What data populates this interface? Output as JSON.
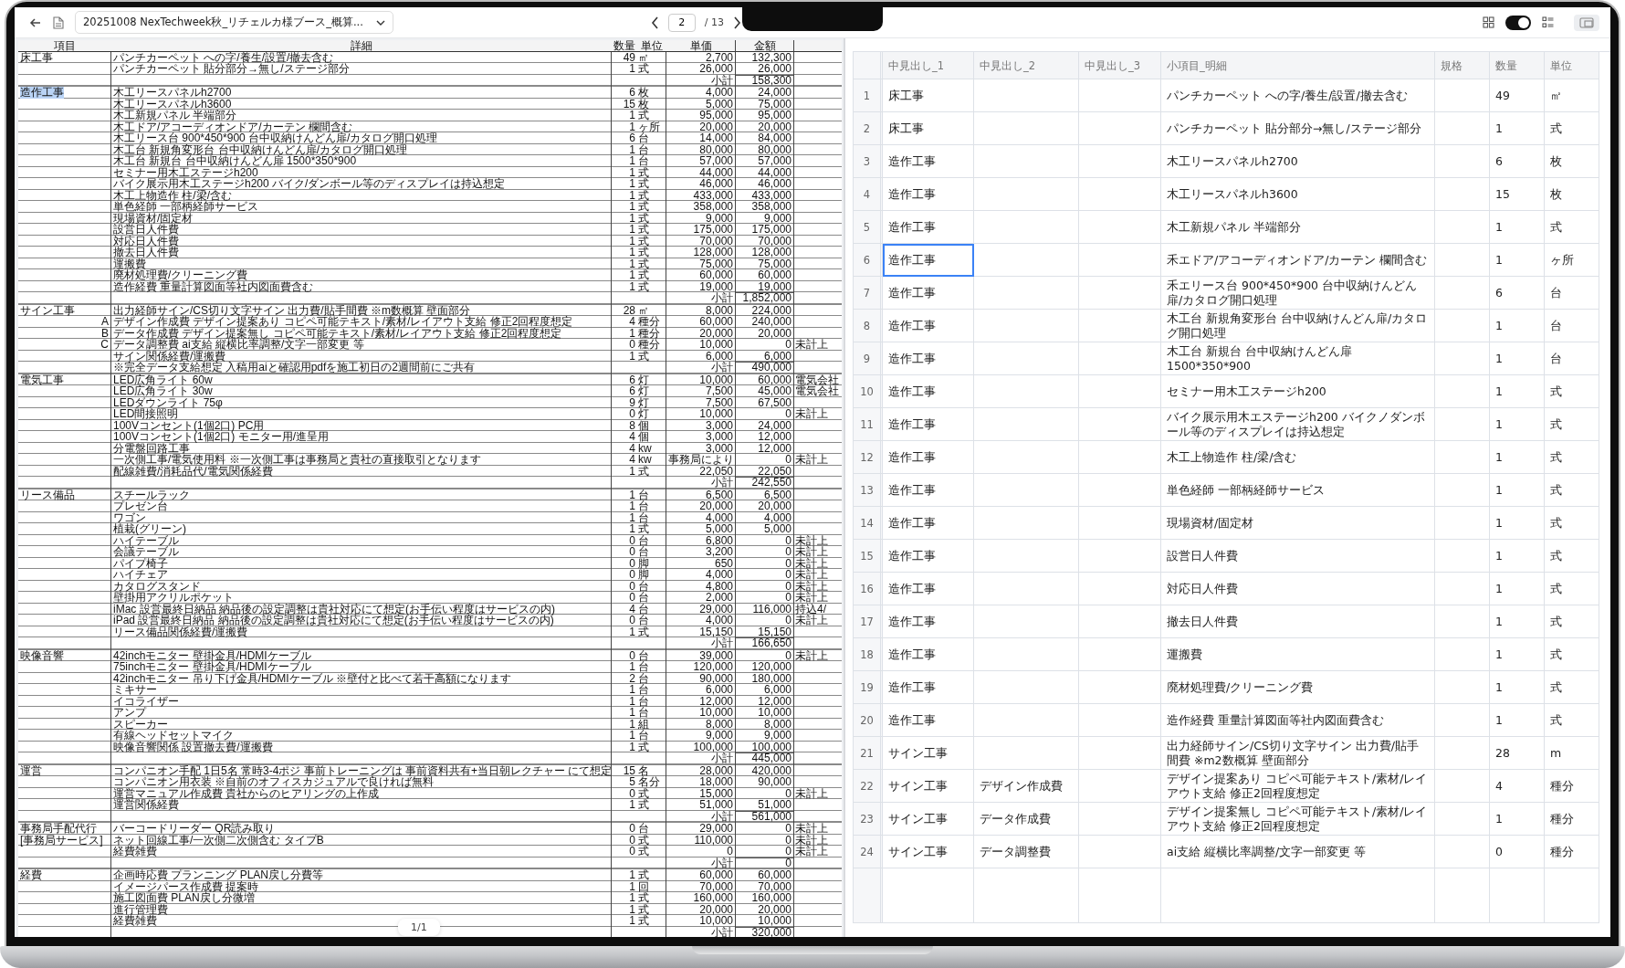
{
  "toolbar": {
    "file_title": "20251008 NexTechweek秋_リチェルカ様ブース_概算...",
    "page": "2",
    "page_total": "/ 13",
    "view_toggle": {
      "on": true
    }
  },
  "pdf": {
    "columns": [
      "項目",
      "詳細",
      "数量",
      "単位",
      "単価",
      "金額"
    ],
    "page_indicator": "1/1",
    "sections": [
      {
        "label": "床工事",
        "highlighted": false,
        "subtotal_label": "小計",
        "subtotal": "158,300",
        "rows": [
          {
            "detail": "パンチカーペット への字/養生/設置/撤去含む",
            "qty": "49",
            "unit": "㎡",
            "price": "2,700",
            "amount": "132,300"
          },
          {
            "detail": "パンチカーペット 貼分部分→無し/ステージ部分",
            "qty": "1",
            "unit": "式",
            "price": "26,000",
            "amount": "26,000"
          }
        ]
      },
      {
        "label": "造作工事",
        "highlighted": true,
        "subtotal_label": "小計",
        "subtotal": "1,852,000",
        "rows": [
          {
            "detail": "木工リースパネルh2700",
            "qty": "6",
            "unit": "枚",
            "price": "4,000",
            "amount": "24,000"
          },
          {
            "detail": "木工リースパネルh3600",
            "qty": "15",
            "unit": "枚",
            "price": "5,000",
            "amount": "75,000"
          },
          {
            "detail": "木工新規パネル 半端部分",
            "qty": "1",
            "unit": "式",
            "price": "95,000",
            "amount": "95,000"
          },
          {
            "detail": "木工ドア/アコーディオンドア/カーテン 欄間含む",
            "qty": "1",
            "unit": "ヶ所",
            "price": "20,000",
            "amount": "20,000"
          },
          {
            "detail": "木工リース台 900*450*900 台中収納けんどん扉/カタログ開口処理",
            "qty": "6",
            "unit": "台",
            "price": "14,000",
            "amount": "84,000"
          },
          {
            "detail": "木工台 新規角変形台 台中収納けんどん扉/カタログ開口処理",
            "qty": "1",
            "unit": "台",
            "price": "80,000",
            "amount": "80,000"
          },
          {
            "detail": "木工台 新規台 台中収納けんどん扉 1500*350*900",
            "qty": "1",
            "unit": "台",
            "price": "57,000",
            "amount": "57,000"
          },
          {
            "detail": "セミナー用木工ステージh200",
            "qty": "1",
            "unit": "式",
            "price": "44,000",
            "amount": "44,000"
          },
          {
            "detail": "バイク展示用木工ステージh200 バイク/ダンボール等のディスプレイは持込想定",
            "qty": "1",
            "unit": "式",
            "price": "46,000",
            "amount": "46,000"
          },
          {
            "detail": "木工上物造作 柱/梁/含む",
            "qty": "1",
            "unit": "式",
            "price": "433,000",
            "amount": "433,000"
          },
          {
            "detail": "単色経師 一部柄経師サービス",
            "qty": "1",
            "unit": "式",
            "price": "358,000",
            "amount": "358,000"
          },
          {
            "detail": "現場資材/固定材",
            "qty": "1",
            "unit": "式",
            "price": "9,000",
            "amount": "9,000"
          },
          {
            "detail": "設営日人件費",
            "qty": "1",
            "unit": "式",
            "price": "175,000",
            "amount": "175,000"
          },
          {
            "detail": "対応日人件費",
            "qty": "1",
            "unit": "式",
            "price": "70,000",
            "amount": "70,000"
          },
          {
            "detail": "撤去日人件費",
            "qty": "1",
            "unit": "式",
            "price": "128,000",
            "amount": "128,000"
          },
          {
            "detail": "運搬費",
            "qty": "1",
            "unit": "式",
            "price": "75,000",
            "amount": "75,000"
          },
          {
            "detail": "廃材処理費/クリーニング費",
            "qty": "1",
            "unit": "式",
            "price": "60,000",
            "amount": "60,000"
          },
          {
            "detail": "造作経費 重量計算図面等社内図面費含む",
            "qty": "1",
            "unit": "式",
            "price": "19,000",
            "amount": "19,000"
          }
        ]
      },
      {
        "label": "サイン工事",
        "highlighted": false,
        "subtotal_label": "小計",
        "subtotal": "490,000",
        "subtotal_note": "※完全データ支給想定 入稿用aiと確認用pdfを施工初日の2週間前にご共有",
        "rows": [
          {
            "detail": "出力経師サイン/CS切り文字サイン 出力費/貼手間費 ※m数概算 壁面部分",
            "qty": "28",
            "unit": "㎡",
            "price": "8,000",
            "amount": "224,000"
          },
          {
            "letter": "A",
            "detail": "デザイン作成費 デザイン提案あり コピペ可能テキスト/素材/レイアウト支給 修正2回程度想定",
            "qty": "4",
            "unit": "種分",
            "price": "60,000",
            "amount": "240,000"
          },
          {
            "letter": "B",
            "detail": "データ作成費 デザイン提案無し コピペ可能テキスト/素材/レイアウト支給 修正2回程度想定",
            "qty": "1",
            "unit": "種分",
            "price": "20,000",
            "amount": "20,000"
          },
          {
            "letter": "C",
            "detail": "データ調整費 ai支給 縦横比率調整/文字一部変更 等",
            "qty": "0",
            "unit": "種分",
            "price": "10,000",
            "amount": "0",
            "note": "未計上"
          },
          {
            "detail": "サイン関係経費/運搬費",
            "qty": "1",
            "unit": "式",
            "price": "6,000",
            "amount": "6,000"
          }
        ]
      },
      {
        "label": "電気工事",
        "highlighted": false,
        "subtotal_label": "小計",
        "subtotal": "242,550",
        "rows": [
          {
            "detail": "LED広角ライト 60w",
            "qty": "6",
            "unit": "灯",
            "price": "10,000",
            "amount": "60,000",
            "note": "電気会社"
          },
          {
            "detail": "LED広角ライト 30w",
            "qty": "6",
            "unit": "灯",
            "price": "7,500",
            "amount": "45,000",
            "note": "電気会社"
          },
          {
            "detail": "LEDダウンライト 75φ",
            "qty": "9",
            "unit": "灯",
            "price": "7,500",
            "amount": "67,500"
          },
          {
            "detail": "LED間接照明",
            "qty": "0",
            "unit": "灯",
            "price": "10,000",
            "amount": "0",
            "note": "未計上"
          },
          {
            "detail": "100Vコンセント(1個2口) PC用",
            "qty": "8",
            "unit": "個",
            "price": "3,000",
            "amount": "24,000"
          },
          {
            "detail": "100Vコンセント(1個2口) モニター用/進呈用",
            "qty": "4",
            "unit": "個",
            "price": "3,000",
            "amount": "12,000"
          },
          {
            "detail": "分電盤回路工事",
            "qty": "4",
            "unit": "kw",
            "price": "3,000",
            "amount": "12,000"
          },
          {
            "detail": "一次側工事/電気使用料 ※一次側工事は事務局と貴社の直接取引となります",
            "qty": "4",
            "unit": "kw",
            "price": "事務局により",
            "amount": "0",
            "note": "未計上"
          },
          {
            "detail": "配線雑費/消耗品代/電気関係経費",
            "qty": "1",
            "unit": "式",
            "price": "22,050",
            "amount": "22,050"
          }
        ]
      },
      {
        "label": "リース備品",
        "highlighted": false,
        "subtotal_label": "小計",
        "subtotal": "166,650",
        "rows": [
          {
            "detail": "スチールラック",
            "qty": "1",
            "unit": "台",
            "price": "6,500",
            "amount": "6,500"
          },
          {
            "detail": "プレゼン台",
            "qty": "1",
            "unit": "台",
            "price": "20,000",
            "amount": "20,000"
          },
          {
            "detail": "ワゴン",
            "qty": "1",
            "unit": "台",
            "price": "4,000",
            "amount": "4,000"
          },
          {
            "detail": "植栽(グリーン)",
            "qty": "1",
            "unit": "式",
            "price": "5,000",
            "amount": "5,000"
          },
          {
            "detail": "ハイテーブル",
            "qty": "0",
            "unit": "台",
            "price": "6,800",
            "amount": "0",
            "note": "未計上"
          },
          {
            "detail": "会議テーブル",
            "qty": "0",
            "unit": "台",
            "price": "3,200",
            "amount": "0",
            "note": "未計上"
          },
          {
            "detail": "パイプ椅子",
            "qty": "0",
            "unit": "脚",
            "price": "650",
            "amount": "0",
            "note": "未計上"
          },
          {
            "detail": "ハイチェア",
            "qty": "0",
            "unit": "脚",
            "price": "4,000",
            "amount": "0",
            "note": "未計上"
          },
          {
            "detail": "カタログスタンド",
            "qty": "0",
            "unit": "台",
            "price": "4,800",
            "amount": "0",
            "note": "未計上"
          },
          {
            "detail": "壁掛用アクリルポケット",
            "qty": "0",
            "unit": "台",
            "price": "2,000",
            "amount": "0",
            "note": "未計上"
          },
          {
            "detail": "iMac 設営最終日納品 納品後の設定調整は貴社対応にて想定(お手伝い程度はサービスの内)",
            "qty": "4",
            "unit": "台",
            "price": "29,000",
            "amount": "116,000",
            "note": "持込4/"
          },
          {
            "detail": "iPad 設営最終日納品 納品後の設定調整は貴社対応にて想定(お手伝い程度はサービスの内)",
            "qty": "0",
            "unit": "台",
            "price": "4,000",
            "amount": "0",
            "note": "未計上"
          },
          {
            "detail": "リース備品関係経費/運搬費",
            "qty": "1",
            "unit": "式",
            "price": "15,150",
            "amount": "15,150"
          }
        ]
      },
      {
        "label": "映像音響",
        "highlighted": false,
        "subtotal_label": "小計",
        "subtotal": "445,000",
        "rows": [
          {
            "detail": "42inchモニター 壁掛金具/HDMIケーブル",
            "qty": "0",
            "unit": "台",
            "price": "39,000",
            "amount": "0",
            "note": "未計上"
          },
          {
            "detail": "75inchモニター 壁掛金具/HDMIケーブル",
            "qty": "1",
            "unit": "台",
            "price": "120,000",
            "amount": "120,000"
          },
          {
            "detail": "42inchモニター 吊り下げ金具/HDMIケーブル ※壁付と比べて若干高額になります",
            "qty": "2",
            "unit": "台",
            "price": "90,000",
            "amount": "180,000"
          },
          {
            "detail": "ミキサー",
            "qty": "1",
            "unit": "台",
            "price": "6,000",
            "amount": "6,000"
          },
          {
            "detail": "イコライザー",
            "qty": "1",
            "unit": "台",
            "price": "12,000",
            "amount": "12,000"
          },
          {
            "detail": "アンプ",
            "qty": "1",
            "unit": "台",
            "price": "10,000",
            "amount": "10,000"
          },
          {
            "detail": "スピーカー",
            "qty": "1",
            "unit": "組",
            "price": "8,000",
            "amount": "8,000"
          },
          {
            "detail": "有線ヘッドセットマイク",
            "qty": "1",
            "unit": "台",
            "price": "9,000",
            "amount": "9,000"
          },
          {
            "detail": "映像音響関係 設置撤去費/運搬費",
            "qty": "1",
            "unit": "式",
            "price": "100,000",
            "amount": "100,000"
          }
        ]
      },
      {
        "label": "運営",
        "highlighted": false,
        "subtotal_label": "小計",
        "subtotal": "561,000",
        "rows": [
          {
            "detail": "コンパニオン手配 1日5名 常時3-4ポジ 事前トレーニングは 事前資料共有+当日朝レクチャー にて想定",
            "qty": "15",
            "unit": "名",
            "price": "28,000",
            "amount": "420,000"
          },
          {
            "detail": "コンパニオン用衣装 ※自前のオフィスカジュアルで良ければ無料",
            "qty": "5",
            "unit": "名分",
            "price": "18,000",
            "amount": "90,000"
          },
          {
            "detail": "運営マニュアル作成費 貴社からのヒアリングの上作成",
            "qty": "0",
            "unit": "式",
            "price": "15,000",
            "amount": "0",
            "note": "未計上"
          },
          {
            "detail": "運営関係経費",
            "qty": "1",
            "unit": "式",
            "price": "51,000",
            "amount": "51,000"
          }
        ]
      },
      {
        "label": "事務局手配代行",
        "sublabel": "[事務局サービス]",
        "highlighted": false,
        "subtotal_label": "小計",
        "subtotal": "0",
        "rows": [
          {
            "detail": "バーコードリーダー QR読み取り",
            "qty": "0",
            "unit": "台",
            "price": "29,000",
            "amount": "0",
            "note": "未計上"
          },
          {
            "detail": "ネット回線工事/一次側二次側含む タイプB",
            "qty": "0",
            "unit": "式",
            "price": "110,000",
            "amount": "0",
            "note": "未計上"
          },
          {
            "detail": "経費雑費",
            "qty": "0",
            "unit": "式",
            "price": "0",
            "amount": "0",
            "note": "未計上"
          }
        ]
      },
      {
        "label": "経費",
        "highlighted": false,
        "subtotal_label": "小計",
        "subtotal": "320,000",
        "rows": [
          {
            "detail": "企画時応費 プランニング PLAN戻し分費等",
            "qty": "1",
            "unit": "式",
            "price": "60,000",
            "amount": "60,000"
          },
          {
            "detail": "イメージパース作成費 提案時",
            "qty": "1",
            "unit": "回",
            "price": "70,000",
            "amount": "70,000"
          },
          {
            "detail": "施工図面費 PLAN戻し分微増",
            "qty": "1",
            "unit": "式",
            "price": "160,000",
            "amount": "160,000"
          },
          {
            "detail": "進行管理費",
            "qty": "1",
            "unit": "式",
            "price": "20,000",
            "amount": "20,000"
          },
          {
            "detail": "経費雑費",
            "qty": "1",
            "unit": "式",
            "price": "10,000",
            "amount": "10,000"
          }
        ]
      }
    ]
  },
  "table": {
    "columns": [
      "中見出し_1",
      "中見出し_2",
      "中見出し_3",
      "小項目_明細",
      "規格",
      "数量",
      "単位"
    ],
    "rows": [
      {
        "num": "1",
        "h1": "床工事",
        "detail": "パンチカーペット への字/養生/設置/撤去含む",
        "qty": "49",
        "unit": "㎡",
        "selected": false
      },
      {
        "num": "2",
        "h1": "床工事",
        "detail": "パンチカーペット 貼分部分→無し/ステージ部分",
        "qty": "1",
        "unit": "式",
        "selected": false
      },
      {
        "num": "3",
        "h1": "造作工事",
        "detail": "木工リースパネルh2700",
        "qty": "6",
        "unit": "枚",
        "selected": false
      },
      {
        "num": "4",
        "h1": "造作工事",
        "detail": "木工リースパネルh3600",
        "qty": "15",
        "unit": "枚",
        "selected": false
      },
      {
        "num": "5",
        "h1": "造作工事",
        "detail": "木工新規パネル 半端部分",
        "qty": "1",
        "unit": "式",
        "selected": false
      },
      {
        "num": "6",
        "h1": "造作工事",
        "detail": "禾エドア/アコーディオンドア/カーテン 欄間含む",
        "qty": "1",
        "unit": "ヶ所",
        "selected": true
      },
      {
        "num": "7",
        "h1": "造作工事",
        "detail": "禾エリース台 900*450*900 台中収納けんどん扉/カタログ開口処理",
        "qty": "6",
        "unit": "台",
        "selected": false
      },
      {
        "num": "8",
        "h1": "造作工事",
        "detail": "木工台 新規角変形台 台中収納けんどん扉/カタログ開口処理",
        "qty": "1",
        "unit": "台",
        "selected": false
      },
      {
        "num": "9",
        "h1": "造作工事",
        "detail": "木工台 新規台 台中収納けんどん扉 1500*350*900",
        "qty": "1",
        "unit": "台",
        "selected": false
      },
      {
        "num": "10",
        "h1": "造作工事",
        "detail": "セミナー用木工ステージh200",
        "qty": "1",
        "unit": "式",
        "selected": false
      },
      {
        "num": "11",
        "h1": "造作工事",
        "detail": "バイク展示用木エステージh200 バイクノダンボール等のディスプレイは持込想定",
        "qty": "1",
        "unit": "式",
        "selected": false
      },
      {
        "num": "12",
        "h1": "造作工事",
        "detail": "木工上物造作 柱/梁/含む",
        "qty": "1",
        "unit": "式",
        "selected": false
      },
      {
        "num": "13",
        "h1": "造作工事",
        "detail": "単色経師 一部柄経師サービス",
        "qty": "1",
        "unit": "式",
        "selected": false
      },
      {
        "num": "14",
        "h1": "造作工事",
        "detail": "現場資材/固定材",
        "qty": "1",
        "unit": "式",
        "selected": false
      },
      {
        "num": "15",
        "h1": "造作工事",
        "detail": "設営日人件費",
        "qty": "1",
        "unit": "式",
        "selected": false
      },
      {
        "num": "16",
        "h1": "造作工事",
        "detail": "対応日人件費",
        "qty": "1",
        "unit": "式",
        "selected": false
      },
      {
        "num": "17",
        "h1": "造作工事",
        "detail": "撤去日人件費",
        "qty": "1",
        "unit": "式",
        "selected": false
      },
      {
        "num": "18",
        "h1": "造作工事",
        "detail": "運搬費",
        "qty": "1",
        "unit": "式",
        "selected": false
      },
      {
        "num": "19",
        "h1": "造作工事",
        "detail": "廃材処理費/クリーニング費",
        "qty": "1",
        "unit": "式",
        "selected": false
      },
      {
        "num": "20",
        "h1": "造作工事",
        "detail": "造作経費 重量計算図面等社内図面費含む",
        "qty": "1",
        "unit": "式",
        "selected": false
      },
      {
        "num": "21",
        "h1": "サイン工事",
        "detail": "出力経師サイン/CS切り文字サイン 出力費/貼手間費 ※m2数概算 壁面部分",
        "qty": "28",
        "unit": "m",
        "selected": false
      },
      {
        "num": "22",
        "h1": "サイン工事",
        "h2": "デザイン作成費",
        "detail": "デザイン提案あり コピペ可能テキスト/素材/レイアウト支給 修正2回程度想定",
        "qty": "4",
        "unit": "種分",
        "selected": false
      },
      {
        "num": "23",
        "h1": "サイン工事",
        "h2": "データ作成費",
        "detail": "デザイン提案無し コピペ可能テキスト/素材/レイアウト支給 修正2回程度想定",
        "qty": "1",
        "unit": "種分",
        "selected": false
      },
      {
        "num": "24",
        "h1": "サイン工事",
        "h2": "データ調整費",
        "detail": "ai支給 縦横比率調整/文字一部変更 等",
        "qty": "0",
        "unit": "種分",
        "selected": false
      }
    ]
  }
}
